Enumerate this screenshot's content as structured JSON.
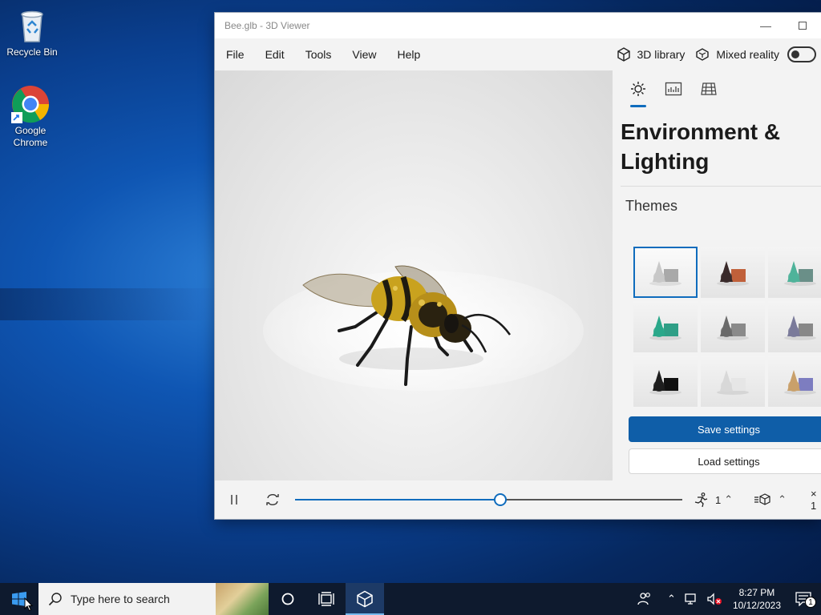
{
  "desktop": {
    "icons": [
      {
        "label": "Recycle Bin",
        "icon": "recycle-bin-icon"
      },
      {
        "label": "Google\nChrome",
        "icon": "chrome-icon"
      }
    ]
  },
  "window": {
    "title": "Bee.glb - 3D Viewer",
    "menu": [
      "File",
      "Edit",
      "Tools",
      "View",
      "Help"
    ],
    "library_label": "3D library",
    "mixed_reality_label": "Mixed reality",
    "mixed_reality_on": false
  },
  "side_panel": {
    "tabs": [
      "sun-icon",
      "stats-icon",
      "grid-icon"
    ],
    "heading": "Environment &\nLighting",
    "subheading": "Themes",
    "themes": [
      {
        "colors": [
          "#c8c8c8",
          "#a9a9a9"
        ],
        "selected": true
      },
      {
        "colors": [
          "#3a2a2a",
          "#c0603a"
        ],
        "selected": false
      },
      {
        "colors": [
          "#4fb39a",
          "#6a8f88"
        ],
        "selected": false
      },
      {
        "colors": [
          "#2aa88a",
          "#2f9f86"
        ],
        "selected": false
      },
      {
        "colors": [
          "#6a6a6a",
          "#8a8a8a"
        ],
        "selected": false
      },
      {
        "colors": [
          "#7a7a9a",
          "#888888"
        ],
        "selected": false
      },
      {
        "colors": [
          "#1e1e1e",
          "#111111"
        ],
        "selected": false
      },
      {
        "colors": [
          "#d8d8d8",
          "#e6e6e6"
        ],
        "selected": false
      },
      {
        "colors": [
          "#c9a06a",
          "#7d7dc0"
        ],
        "selected": false
      }
    ],
    "save_label": "Save settings",
    "load_label": "Load settings"
  },
  "playbar": {
    "progress": 0.53,
    "speed_value": "1",
    "multiplier": "× 1"
  },
  "taskbar": {
    "search_placeholder": "Type here to search",
    "time": "8:27 PM",
    "date": "10/12/2023",
    "notification_count": "1"
  },
  "colors": {
    "accent": "#0f6cbd",
    "save_button": "#0f5ea8"
  }
}
